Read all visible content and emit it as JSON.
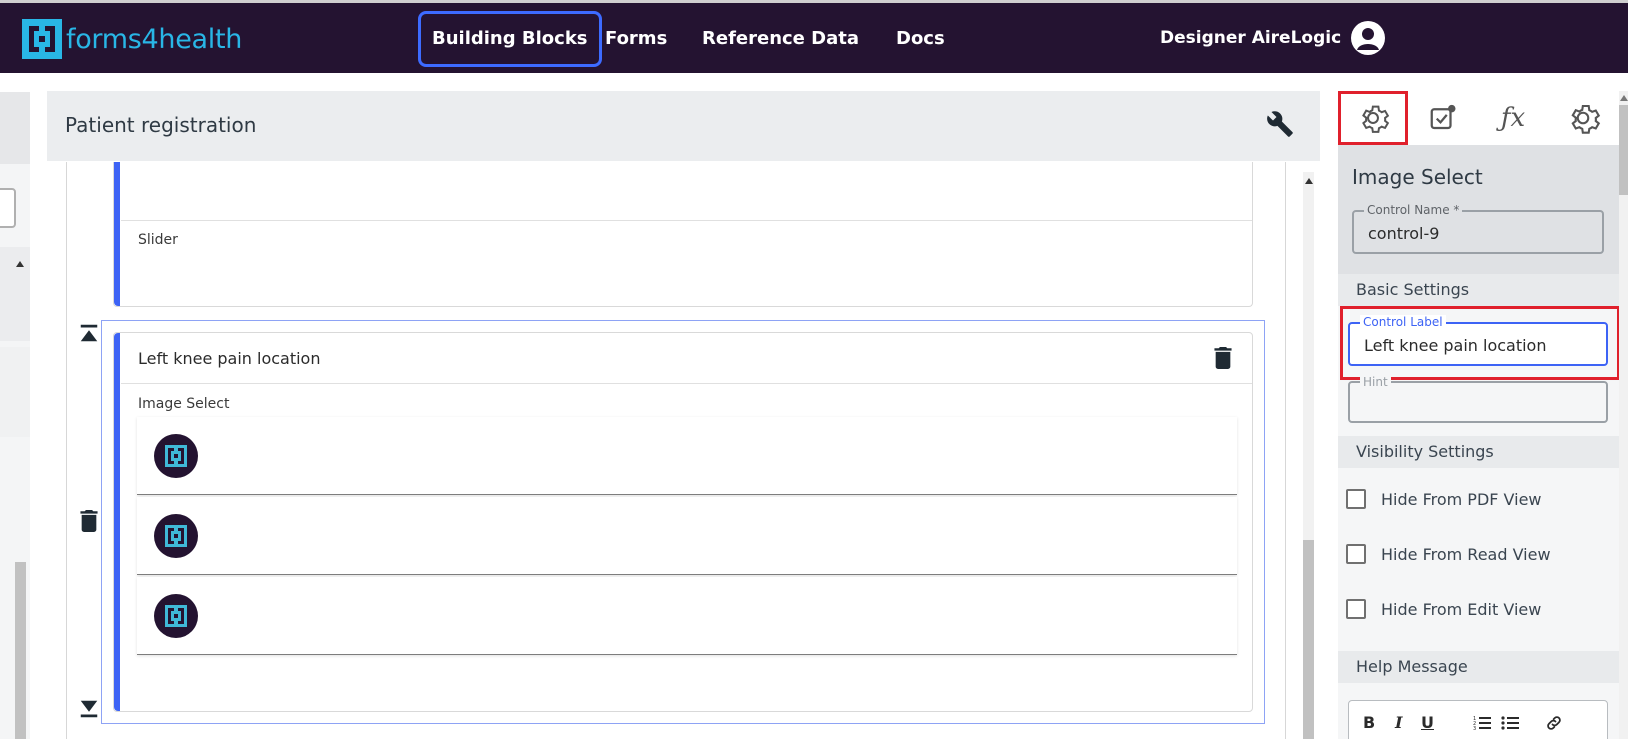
{
  "app": {
    "brand": "forms4health",
    "nav": [
      "Building Blocks",
      "Forms",
      "Reference Data",
      "Docs"
    ],
    "active_nav": "Building Blocks",
    "user": "Designer AireLogic"
  },
  "main": {
    "title": "Patient registration",
    "cards": [
      {
        "type_label": "Slider"
      },
      {
        "title": "Left knee pain location",
        "type_label": "Image Select",
        "image_count": 3
      }
    ]
  },
  "panel": {
    "tabs": [
      "settings-icon",
      "validation-icon",
      "fx-icon",
      "advanced-settings-icon"
    ],
    "selected_tab": 0,
    "title": "Image Select",
    "control_name_label": "Control Name *",
    "control_name_value": "control-9",
    "basic_settings": "Basic Settings",
    "control_label_label": "Control Label",
    "control_label_value": "Left knee pain location",
    "hint_label": "Hint",
    "visibility_settings": "Visibility Settings",
    "checkboxes": [
      "Hide From PDF View",
      "Hide From Read View",
      "Hide From Edit View"
    ],
    "help_message": "Help Message",
    "editor_tools": {
      "bold": "B",
      "italic": "I",
      "underline": "U"
    }
  },
  "colors": {
    "topbar": "#241331",
    "brand_cyan": "#29b6e6",
    "accent_blue": "#3d63f5",
    "highlight_red": "#e0202c"
  }
}
